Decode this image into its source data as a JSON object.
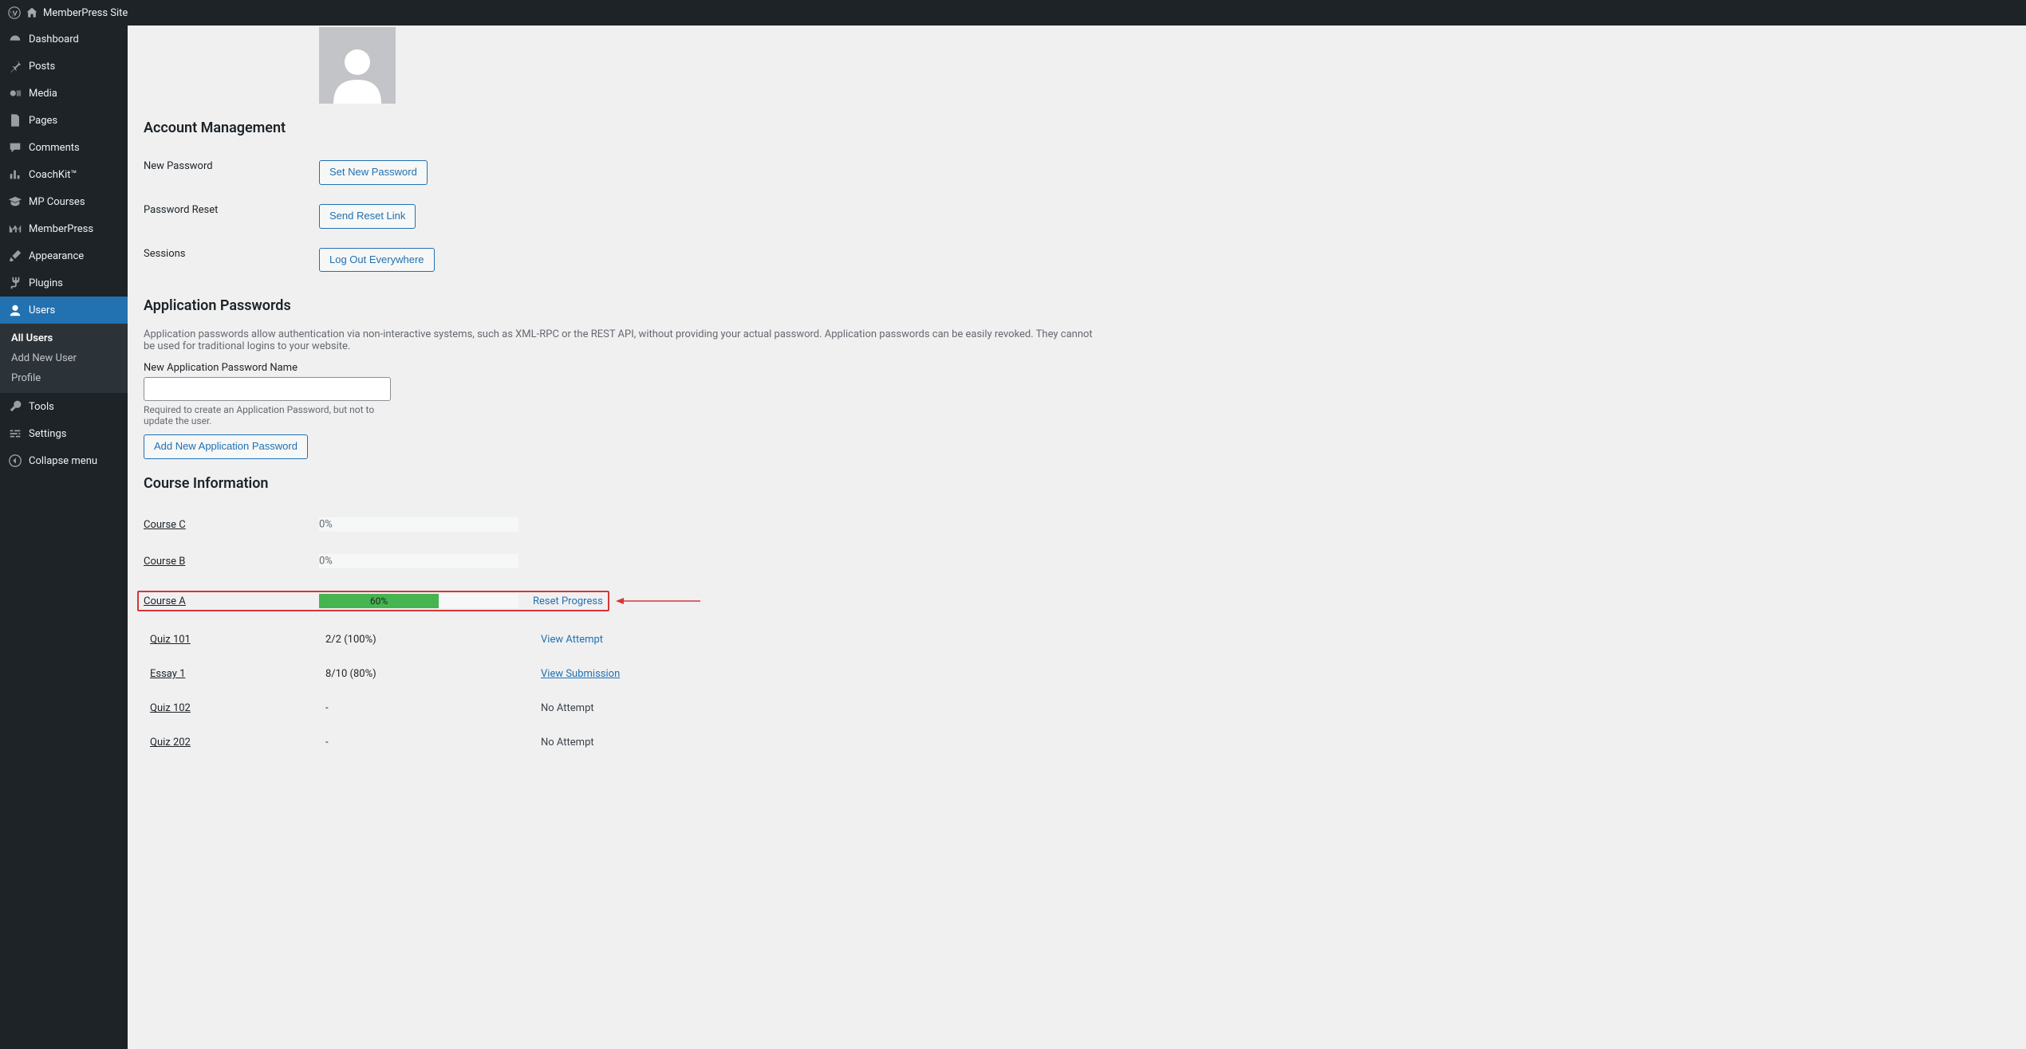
{
  "topbar": {
    "site_name": "MemberPress Site"
  },
  "sidebar": {
    "items": [
      {
        "icon": "dashboard",
        "label": "Dashboard"
      },
      {
        "icon": "pin",
        "label": "Posts"
      },
      {
        "icon": "media",
        "label": "Media"
      },
      {
        "icon": "page",
        "label": "Pages"
      },
      {
        "icon": "comment",
        "label": "Comments"
      },
      {
        "icon": "chart",
        "label": "CoachKit™"
      },
      {
        "icon": "cap",
        "label": "MP Courses"
      },
      {
        "icon": "mp",
        "label": "MemberPress"
      },
      {
        "icon": "brush",
        "label": "Appearance"
      },
      {
        "icon": "plug",
        "label": "Plugins"
      },
      {
        "icon": "user",
        "label": "Users"
      },
      {
        "icon": "wrench",
        "label": "Tools"
      },
      {
        "icon": "sliders",
        "label": "Settings"
      },
      {
        "icon": "collapse",
        "label": "Collapse menu"
      }
    ],
    "submenu": [
      {
        "label": "All Users",
        "current": true
      },
      {
        "label": "Add New User"
      },
      {
        "label": "Profile"
      }
    ]
  },
  "sections": {
    "account_mgmt": "Account Management",
    "app_passwords": "Application Passwords",
    "course_info": "Course Information"
  },
  "account": {
    "new_password_label": "New Password",
    "set_password_btn": "Set New Password",
    "reset_label": "Password Reset",
    "reset_btn": "Send Reset Link",
    "sessions_label": "Sessions",
    "logout_btn": "Log Out Everywhere"
  },
  "app_pw": {
    "desc": "Application passwords allow authentication via non-interactive systems, such as XML-RPC or the REST API, without providing your actual password. Application passwords can be easily revoked. They cannot be used for traditional logins to your website.",
    "new_name_label": "New Application Password Name",
    "name_hint": "Required to create an Application Password, but not to update the user.",
    "add_btn": "Add New Application Password"
  },
  "courses": [
    {
      "name": "Course C",
      "percent": 0,
      "action": null
    },
    {
      "name": "Course B",
      "percent": 0,
      "action": null
    },
    {
      "name": "Course A",
      "percent": 60,
      "action": "Reset Progress",
      "highlight": true
    }
  ],
  "assessments": [
    {
      "name": "Quiz 101",
      "score": "2/2 (100%)",
      "action": "View Attempt",
      "underline": false
    },
    {
      "name": "Essay 1",
      "score": "8/10 (80%)",
      "action": "View Submission",
      "underline": true
    },
    {
      "name": "Quiz 102",
      "score": "-",
      "action_text": "No Attempt"
    },
    {
      "name": "Quiz 202",
      "score": "-",
      "action_text": "No Attempt"
    }
  ]
}
